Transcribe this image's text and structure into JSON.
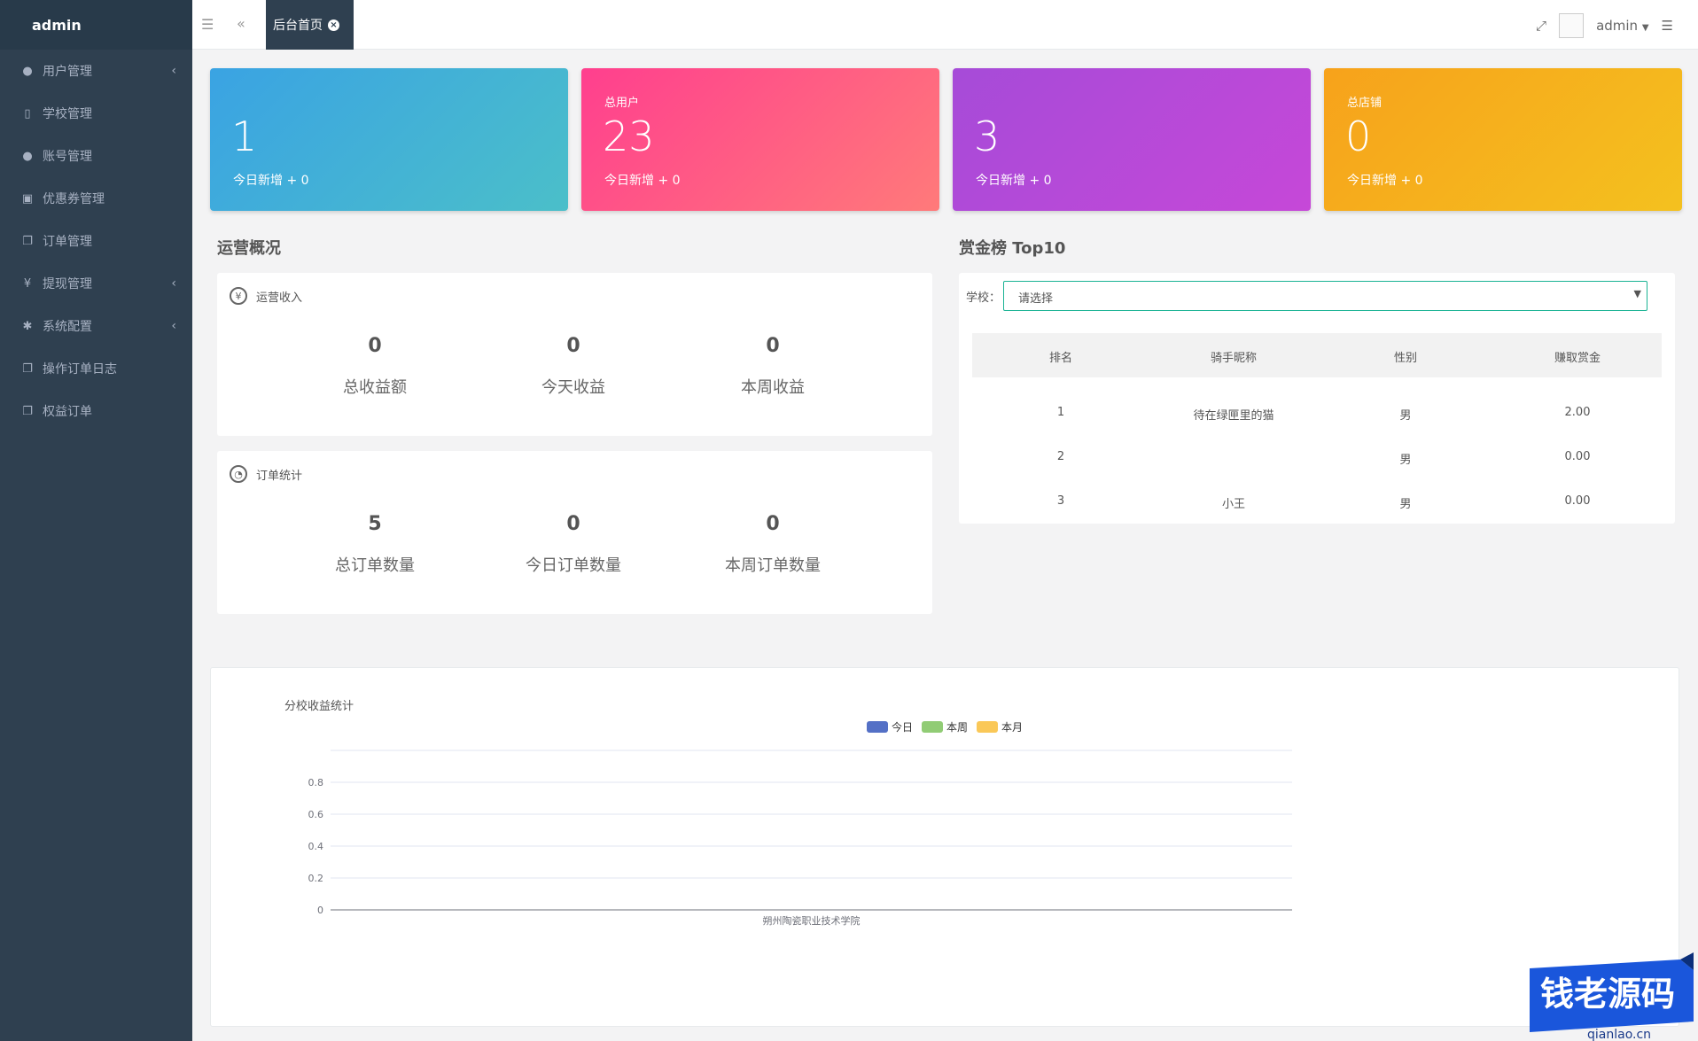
{
  "sidebar": {
    "brand": "admin",
    "items": [
      {
        "label": "用户管理",
        "icon": "user-icon",
        "glyph": "●",
        "has_children": true
      },
      {
        "label": "学校管理",
        "icon": "school-icon",
        "glyph": "▯",
        "has_children": false
      },
      {
        "label": "账号管理",
        "icon": "users-icon",
        "glyph": "●",
        "has_children": false
      },
      {
        "label": "优惠券管理",
        "icon": "coupon-icon",
        "glyph": "▣",
        "has_children": false
      },
      {
        "label": "订单管理",
        "icon": "copy-icon",
        "glyph": "❐",
        "has_children": false
      },
      {
        "label": "提现管理",
        "icon": "yen-icon",
        "glyph": "¥",
        "has_children": true
      },
      {
        "label": "系统配置",
        "icon": "gear-icon",
        "glyph": "✱",
        "has_children": true
      },
      {
        "label": "操作订单日志",
        "icon": "copy-icon",
        "glyph": "❐",
        "has_children": false
      },
      {
        "label": "权益订单",
        "icon": "copy-icon",
        "glyph": "❐",
        "has_children": false
      }
    ]
  },
  "topbar": {
    "tab_label": "后台首页",
    "username": "admin"
  },
  "cards": [
    {
      "title": "",
      "value": "1",
      "sub": "今日新增 + 0",
      "color": "#3aa3e3"
    },
    {
      "title": "总用户",
      "value": "23",
      "sub": "今日新增 + 0",
      "color": "#ff3f8e"
    },
    {
      "title": "",
      "value": "3",
      "sub": "今日新增 + 0",
      "color": "#a64bd8"
    },
    {
      "title": "总店铺",
      "value": "0",
      "sub": "今日新增 + 0",
      "color": "#f7a21b"
    }
  ],
  "overview": {
    "title": "运营概况",
    "income": {
      "title": "运营收入",
      "stats": [
        {
          "value": "0",
          "label": "总收益额"
        },
        {
          "value": "0",
          "label": "今天收益"
        },
        {
          "value": "0",
          "label": "本周收益"
        }
      ]
    },
    "orders": {
      "title": "订单统计",
      "stats": [
        {
          "value": "5",
          "label": "总订单数量"
        },
        {
          "value": "0",
          "label": "今日订单数量"
        },
        {
          "value": "0",
          "label": "本周订单数量"
        }
      ]
    }
  },
  "ranking": {
    "title": "赏金榜 Top10",
    "school_label": "学校：",
    "school_placeholder": "请选择",
    "columns": [
      "排名",
      "骑手昵称",
      "性别",
      "赚取赏金"
    ],
    "rows": [
      [
        "1",
        "待在绿匣里的猫",
        "男",
        "2.00"
      ],
      [
        "2",
        "",
        "男",
        "0.00"
      ],
      [
        "3",
        "小王",
        "男",
        "0.00"
      ]
    ]
  },
  "chart_data": {
    "type": "bar",
    "title": "分校收益统计",
    "categories": [
      "朔州陶瓷职业技术学院"
    ],
    "series": [
      {
        "name": "今日",
        "values": [
          0
        ],
        "color": "#5470c6"
      },
      {
        "name": "本周",
        "values": [
          0
        ],
        "color": "#91cc75"
      },
      {
        "name": "本月",
        "values": [
          0
        ],
        "color": "#fac858"
      }
    ],
    "ylim": [
      0,
      1
    ],
    "yticks": [
      "0",
      "0.2",
      "0.4",
      "0.6",
      "0.8"
    ],
    "grid": true,
    "legend": "top-center"
  },
  "watermark": {
    "text": "钱老源码",
    "url": "qianlao.cn"
  }
}
